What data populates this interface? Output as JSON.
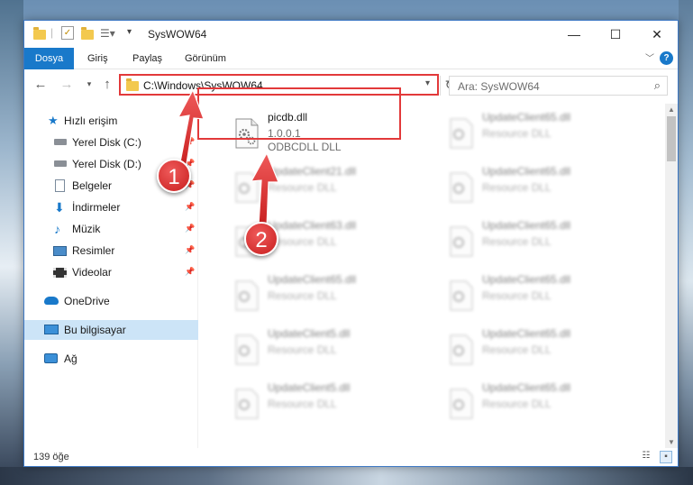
{
  "window": {
    "title": "SysWOW64",
    "controls": {
      "minimize": "—",
      "maximize": "☐",
      "close": "✕"
    }
  },
  "ribbon": {
    "tabs": [
      "Dosya",
      "Giriş",
      "Paylaş",
      "Görünüm"
    ],
    "help": "?"
  },
  "navigation": {
    "address": "C:\\Windows\\SysWOW64",
    "search_placeholder": "Ara: SysWOW64"
  },
  "sidebar": {
    "items": [
      {
        "label": "Hızlı erişim",
        "icon": "star-icon"
      },
      {
        "label": "Yerel Disk (C:)",
        "icon": "drive-icon",
        "pinned": true
      },
      {
        "label": "Yerel Disk (D:)",
        "icon": "drive-icon",
        "pinned": true
      },
      {
        "label": "Belgeler",
        "icon": "documents-icon",
        "pinned": true
      },
      {
        "label": "İndirmeler",
        "icon": "downloads-icon",
        "pinned": true
      },
      {
        "label": "Müzik",
        "icon": "music-icon",
        "pinned": true
      },
      {
        "label": "Resimler",
        "icon": "pictures-icon",
        "pinned": true
      },
      {
        "label": "Videolar",
        "icon": "videos-icon",
        "pinned": true
      },
      {
        "label": "OneDrive",
        "icon": "cloud-icon"
      },
      {
        "label": "Bu bilgisayar",
        "icon": "computer-icon",
        "selected": true
      },
      {
        "label": "Ağ",
        "icon": "network-icon"
      }
    ]
  },
  "files": {
    "focused": {
      "name": "picdb.dll",
      "version": "1.0.0.1",
      "description": "ODBCDLL DLL"
    },
    "left_column": [
      {
        "name": "UpdateClient21.dll",
        "description": "Resource DLL"
      },
      {
        "name": "UpdateClient63.dll",
        "description": "Resource DLL"
      },
      {
        "name": "UpdateClient65.dll",
        "description": "Resource DLL"
      },
      {
        "name": "UpdateClient5.dll",
        "description": "Resource DLL"
      },
      {
        "name": "UpdateClient5.dll",
        "description": "Resource DLL"
      }
    ],
    "right_column": [
      {
        "name": "UpdateClient65.dll",
        "description": "Resource DLL"
      },
      {
        "name": "UpdateClient65.dll",
        "description": "Resource DLL"
      },
      {
        "name": "UpdateClient65.dll",
        "description": "Resource DLL"
      },
      {
        "name": "UpdateClient65.dll",
        "description": "Resource DLL"
      },
      {
        "name": "UpdateClient65.dll",
        "description": "Resource DLL"
      },
      {
        "name": "UpdateClient65.dll",
        "description": "Resource DLL"
      }
    ]
  },
  "status": {
    "item_count": "139 öğe"
  },
  "callouts": {
    "step1": "1",
    "step2": "2"
  },
  "colors": {
    "accent": "#1979ca",
    "highlight": "#e2393a",
    "selection": "#cce4f7"
  }
}
